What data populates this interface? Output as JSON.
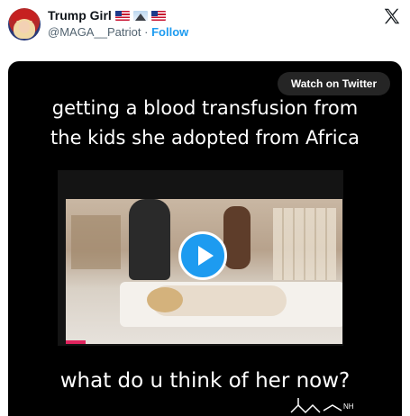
{
  "tweet": {
    "display_name": "Trump Girl",
    "handle": "@MAGA__Patriot",
    "separator": "·",
    "follow_label": "Follow",
    "name_emojis": [
      "us-flag-icon",
      "mountain-icon",
      "us-flag-icon"
    ]
  },
  "media": {
    "watch_label": "Watch on Twitter",
    "caption_top_line1": "getting a blood transfusion from",
    "caption_top_line2": "the kids she adopted from Africa",
    "caption_bottom": "what do u think of her now?",
    "molecule_text": "NH"
  },
  "colors": {
    "accent": "#1d9bf0",
    "text_primary": "#0f1419",
    "text_secondary": "#536471",
    "media_bg": "#000000"
  }
}
